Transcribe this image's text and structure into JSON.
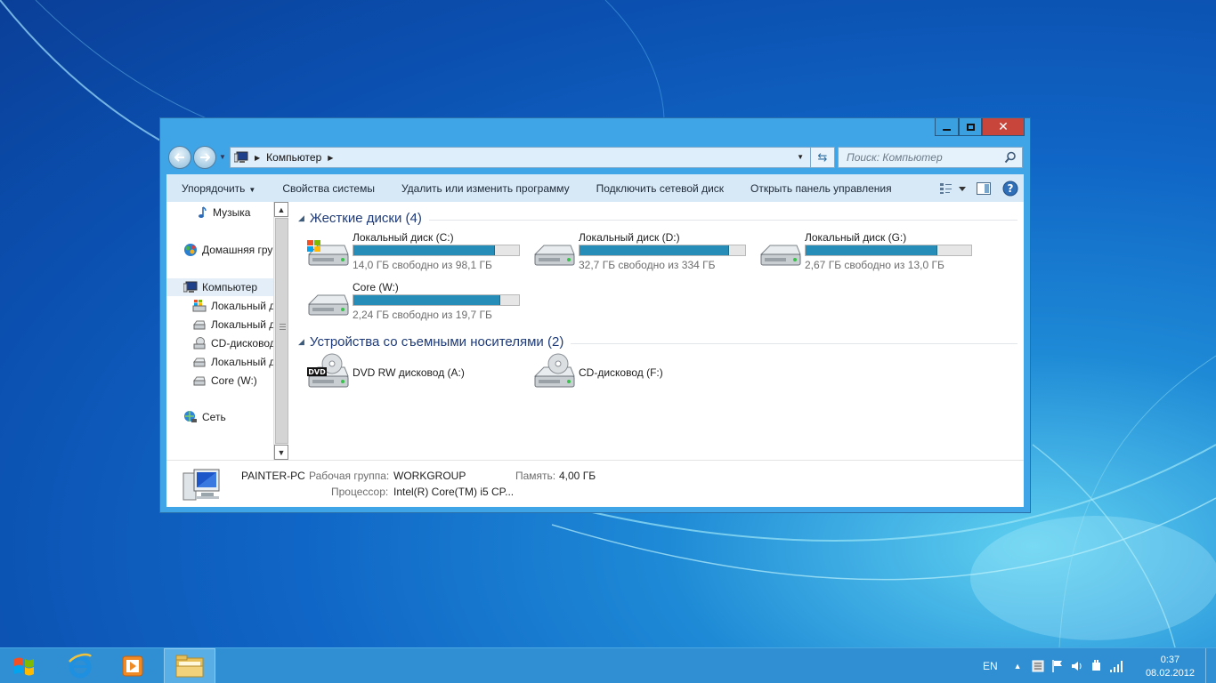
{
  "window": {
    "address_path": "Компьютер",
    "search_placeholder": "Поиск: Компьютер"
  },
  "toolbar": {
    "organize": "Упорядочить",
    "system_properties": "Свойства системы",
    "uninstall": "Удалить или изменить программу",
    "map_network": "Подключить сетевой диск",
    "control_panel": "Открыть панель управления"
  },
  "navpane": {
    "music": "Музыка",
    "homegroup": "Домашняя группа",
    "computer": "Компьютер",
    "children": [
      {
        "label": "Локальный диск (C:)",
        "icon": "windows-drive-icon"
      },
      {
        "label": "Локальный диск (D:)",
        "icon": "hard-drive-icon"
      },
      {
        "label": "CD-дисковод (F:)",
        "icon": "cd-drive-icon"
      },
      {
        "label": "Локальный диск (G:)",
        "icon": "hard-drive-icon"
      },
      {
        "label": "Core (W:)",
        "icon": "hard-drive-icon"
      }
    ],
    "network": "Сеть"
  },
  "groups": {
    "hard_disks": "Жесткие диски (4)",
    "removable": "Устройства со съемными носителями (2)"
  },
  "drives": [
    {
      "name": "Локальный диск (C:)",
      "free": "14,0 ГБ свободно из 98,1 ГБ",
      "used_fraction": 0.857,
      "icon": "windows-drive-icon"
    },
    {
      "name": "Локальный диск (D:)",
      "free": "32,7 ГБ свободно из 334 ГБ",
      "used_fraction": 0.902,
      "icon": "hard-drive-icon"
    },
    {
      "name": "Локальный диск (G:)",
      "free": "2,67 ГБ свободно из 13,0 ГБ",
      "used_fraction": 0.795,
      "icon": "hard-drive-icon"
    },
    {
      "name": "Core (W:)",
      "free": "2,24 ГБ свободно из 19,7 ГБ",
      "used_fraction": 0.886,
      "icon": "hard-drive-icon"
    }
  ],
  "removable": [
    {
      "name": "DVD RW дисковод (A:)",
      "icon": "dvd-drive-icon",
      "badge": "DVD"
    },
    {
      "name": "CD-дисковод (F:)",
      "icon": "cd-drive-icon"
    }
  ],
  "details": {
    "pc_name": "PAINTER-PC",
    "workgroup_label": "Рабочая группа:",
    "workgroup_value": "WORKGROUP",
    "memory_label": "Память:",
    "memory_value": "4,00 ГБ",
    "cpu_label": "Процессор:",
    "cpu_value": "Intel(R) Core(TM) i5 CP..."
  },
  "taskbar": {
    "lang": "EN",
    "time": "0:37",
    "date": "08.02.2012"
  },
  "colors": {
    "drive_bar_fill": "#268db8",
    "window_frame": "#3fa5e6",
    "close_button": "#c7453a",
    "taskbar": "#2f8fd2"
  }
}
